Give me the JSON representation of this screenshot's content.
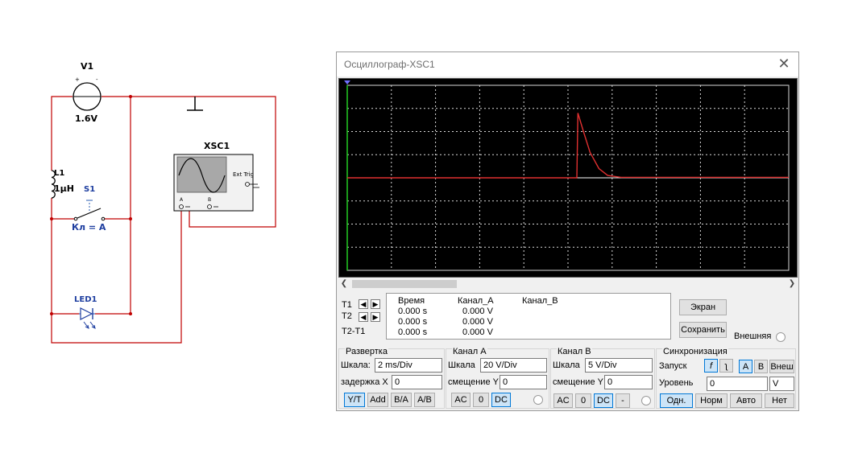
{
  "schematic": {
    "v1_name": "V1",
    "v1_value": "1.6V",
    "v1_plus": "+",
    "v1_minus": "-",
    "scope_name": "XSC1",
    "scope_ext_trig": "Ext Trig",
    "scope_a": "A",
    "scope_b": "B",
    "l1_name": "L1",
    "l1_value": "1µH",
    "s1_name": "S1",
    "s1_key": "Кл = A",
    "led_name": "LED1"
  },
  "window": {
    "title": "Осциллограф-XSC1",
    "close_icon": "close-icon"
  },
  "screen": {
    "background": "#000000",
    "grid_color": "#d9d9d9",
    "trace_a_color": "#e03030",
    "trace_b_color": "#ffffff",
    "cursor_color": "#22cc22"
  },
  "chart_data": {
    "type": "line",
    "x_divisions": 10,
    "y_divisions": 8,
    "x_per_div_ms": 2,
    "y_per_div_v": 20,
    "series": [
      {
        "name": "Канал_A",
        "color": "#e03030",
        "points": [
          [
            0,
            0
          ],
          [
            10.4,
            0
          ],
          [
            10.45,
            56
          ],
          [
            10.7,
            40
          ],
          [
            11.0,
            22
          ],
          [
            11.4,
            8
          ],
          [
            11.8,
            2
          ],
          [
            12.4,
            0.4
          ],
          [
            20,
            0.4
          ]
        ]
      }
    ]
  },
  "readout": {
    "t1": "T1",
    "t2": "T2",
    "t2_t1": "T2-T1",
    "col_time": "Время",
    "col_a": "Канал_A",
    "col_b": "Канал_B",
    "time_vals": [
      "0.000 s",
      "0.000 s",
      "0.000 s"
    ],
    "a_vals": [
      "0.000 V",
      "0.000 V",
      "0.000 V"
    ]
  },
  "side_buttons": {
    "screen": "Экран",
    "save": "Сохранить",
    "external": "Внешняя"
  },
  "timebase": {
    "title": "Развертка",
    "scale_label": "Шкала:",
    "scale_value": "2 ms/Div",
    "delay_label": "задержка X",
    "delay_value": "0",
    "modes": [
      "Y/T",
      "Add",
      "B/A",
      "A/B"
    ]
  },
  "channel_a": {
    "title": "Канал A",
    "scale_label": "Шкала",
    "scale_value": "20  V/Div",
    "offset_label": "смещение Y",
    "offset_value": "0",
    "couplings": [
      "AC",
      "0",
      "DC"
    ]
  },
  "channel_b": {
    "title": "Канал B",
    "scale_label": "Шкала",
    "scale_value": "5  V/Div",
    "offset_label": "смещение Y",
    "offset_value": "0",
    "couplings": [
      "AC",
      "0",
      "DC",
      "-"
    ]
  },
  "sync": {
    "title": "Синхронизация",
    "trigger_label": "Запуск",
    "edge_rise": "f",
    "edge_fall": "ʅ",
    "sources": [
      "A",
      "B",
      "Внеш"
    ],
    "level_label": "Уровень",
    "level_value": "0",
    "level_unit": "V",
    "modes": [
      "Одн.",
      "Норм",
      "Авто",
      "Нет"
    ]
  }
}
